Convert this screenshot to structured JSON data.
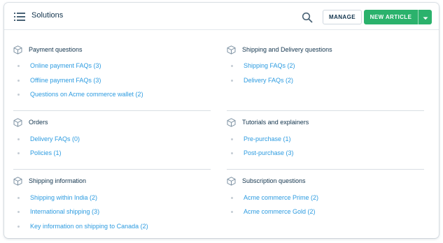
{
  "header": {
    "title": "Solutions",
    "manage_label": "MANAGE",
    "new_article_label": "NEW ARTICLE"
  },
  "icons": {
    "menu": "menu-icon",
    "search": "search-icon",
    "caret": "chevron-down-icon",
    "category": "cube-icon"
  },
  "colors": {
    "accent": "#2bb26c",
    "link": "#2c9be0",
    "text": "#12344d"
  },
  "left": [
    {
      "title": "Payment questions",
      "items": [
        "Online payment FAQs (3)",
        "Offline payment FAQs (3)",
        "Questions on Acme commerce wallet (2)"
      ]
    },
    {
      "title": "Orders",
      "items": [
        "Delivery FAQs (0)",
        "Policies (1)"
      ]
    },
    {
      "title": "Shipping information",
      "items": [
        "Shipping within India (2)",
        "International shipping (3)",
        "Key information on shipping to Canada (2)"
      ]
    }
  ],
  "right": [
    {
      "title": "Shipping and Delivery questions",
      "items": [
        "Shipping FAQs (2)",
        "Delivery FAQs (2)"
      ]
    },
    {
      "title": "Tutorials and explainers",
      "items": [
        "Pre-purchase (1)",
        "Post-purchase (3)"
      ]
    },
    {
      "title": "Subscription questions",
      "items": [
        "Acme commerce Prime (2)",
        "Acme commerce Gold (2)"
      ]
    }
  ]
}
